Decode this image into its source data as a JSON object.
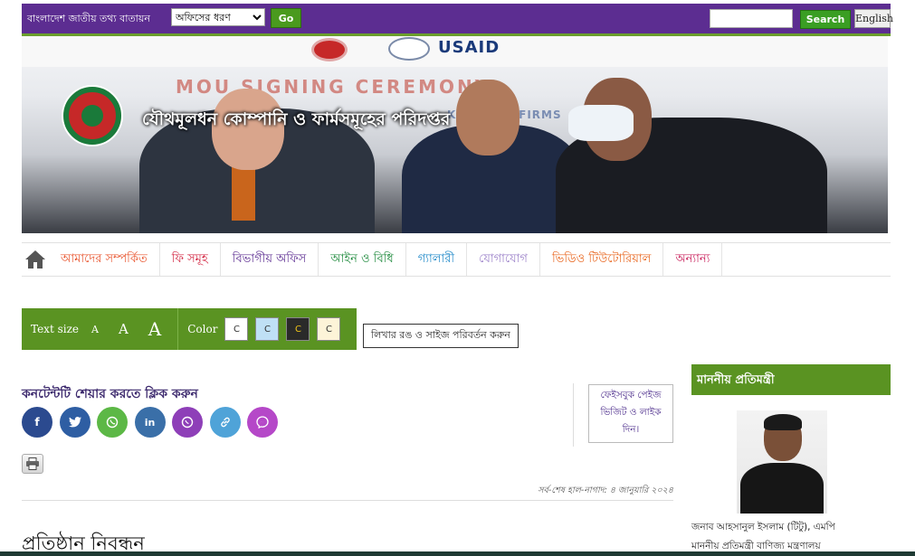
{
  "topbar": {
    "site_name": "বাংলাদেশ জাতীয় তথ্য বাতায়ন",
    "office_select": "অফিসের ধরণ",
    "go_label": "Go",
    "search_placeholder": "",
    "search_label": "Search",
    "language_label": "English"
  },
  "banner": {
    "org_title": "যৌথমূলধন কোম্পানি ও ফার্মসমূহের পরিদপ্তর",
    "backdrop_text": "MOU SIGNING CEREMONY",
    "backdrop_text2": "K CO    AND FIRMS",
    "partner_logo": "USAID"
  },
  "nav": {
    "items": [
      {
        "label": "আমাদের সম্পর্কিত",
        "color": "#e8512a"
      },
      {
        "label": "ফি সমূহ",
        "color": "#d21f3c"
      },
      {
        "label": "বিভাগীয় অফিস",
        "color": "#5c2d91"
      },
      {
        "label": "আইন ও বিধি",
        "color": "#1e8a3c"
      },
      {
        "label": "গ্যালারী",
        "color": "#1e88c8"
      },
      {
        "label": "যোগাযোগ",
        "color": "#9a7fc8"
      },
      {
        "label": "ভিডিও টিউটোরিয়াল",
        "color": "#e8641c"
      },
      {
        "label": "অন্যান্য",
        "color": "#c81e5a"
      }
    ]
  },
  "accessibility": {
    "text_size_label": "Text size",
    "sizes": [
      "A",
      "A",
      "A"
    ],
    "color_label": "Color",
    "colors": [
      {
        "label": "C",
        "bg": "#ffffff",
        "fg": "#333333"
      },
      {
        "label": "C",
        "bg": "#bfe0f5",
        "fg": "#333333"
      },
      {
        "label": "C",
        "bg": "#2a2a2a",
        "fg": "#f0c419"
      },
      {
        "label": "C",
        "bg": "#fdf4d8",
        "fg": "#333333"
      }
    ],
    "hint": "লিখার রঙ ও সাইজ পরিবর্তন করুন"
  },
  "share": {
    "title": "কনটেন্টটি শেয়ার করতে ক্লিক করুন",
    "buttons": [
      {
        "icon": "facebook-icon",
        "glyph": "f",
        "color": "#2b4a8f"
      },
      {
        "icon": "twitter-icon",
        "glyph": "🐦",
        "color": "#2e5ea3"
      },
      {
        "icon": "whatsapp-icon",
        "glyph": "✆",
        "color": "#5cb846"
      },
      {
        "icon": "linkedin-icon",
        "glyph": "in",
        "color": "#3a6fa8"
      },
      {
        "icon": "viber-icon",
        "glyph": "✆",
        "color": "#8e3fb8"
      },
      {
        "icon": "link-icon",
        "glyph": "🔗",
        "color": "#4fa3d8"
      },
      {
        "icon": "messenger-icon",
        "glyph": "⚡",
        "color": "#b548c8"
      }
    ]
  },
  "facebook_box": {
    "line1": "ফেইসবুক পেইজ",
    "line2": "ভিজিট ও লাইক",
    "line3": "দিন।"
  },
  "updated": "সর্ব-শেষ হাল-নাগাদ: ৪ জানুয়ারি ২০২৪",
  "page_title": "প্রতিষ্ঠান নিবন্ধন",
  "sidebar": {
    "heading": "মাননীয় প্রতিমন্ত্রী",
    "name": "জনাব আহসানুল ইসলাম (টিটু), এমপি",
    "role": "মাননীয় প্রতিমন্ত্রী বাণিজ্য মন্ত্রণালয়"
  }
}
